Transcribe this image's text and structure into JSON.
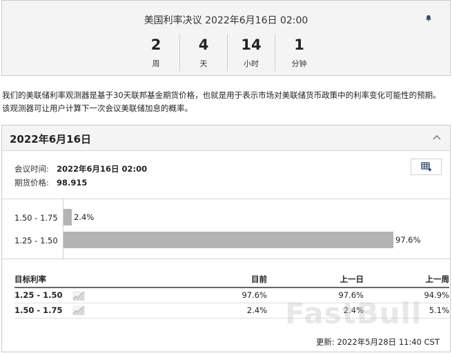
{
  "countdown": {
    "title": "美国利率决议 2022年6月16日 02:00",
    "units": [
      {
        "value": "2",
        "label": "周"
      },
      {
        "value": "4",
        "label": "天"
      },
      {
        "value": "14",
        "label": "小时"
      },
      {
        "value": "1",
        "label": "分钟"
      }
    ]
  },
  "description": "我们的美联储利率观测器是基于30天联邦基金期货价格，也就是用于表示市场对美联储货币政策中的利率变化可能性的预期。该观测器可让用户计算下一次会议美联储加息的概率。",
  "panel": {
    "date": "2022年6月16日",
    "meeting_label": "会议时间:",
    "meeting_value": "2022年6月16日 02:00",
    "futures_label": "期货价格:",
    "futures_value": "98.915",
    "updated": "更新: 2022年5月28日 11:40 CST"
  },
  "chart_data": {
    "type": "bar",
    "orientation": "horizontal",
    "categories": [
      "1.50 - 1.75",
      "1.25 - 1.50"
    ],
    "values": [
      2.4,
      97.6
    ],
    "value_labels": [
      "2.4%",
      "97.6%"
    ],
    "xlim": [
      0,
      100
    ]
  },
  "table": {
    "headers": [
      "目标利率",
      "目前",
      "上一日",
      "上一周"
    ],
    "rows": [
      {
        "rate": "1.25 - 1.50",
        "current": "97.6%",
        "prev_day": "97.6%",
        "prev_week": "94.9%"
      },
      {
        "rate": "1.50 - 1.75",
        "current": "2.4%",
        "prev_day": "2.4%",
        "prev_week": "5.1%"
      }
    ]
  },
  "watermark": "FastBull",
  "colors": {
    "bar": "#b3b3b3",
    "bell": "#2c4a7a"
  }
}
